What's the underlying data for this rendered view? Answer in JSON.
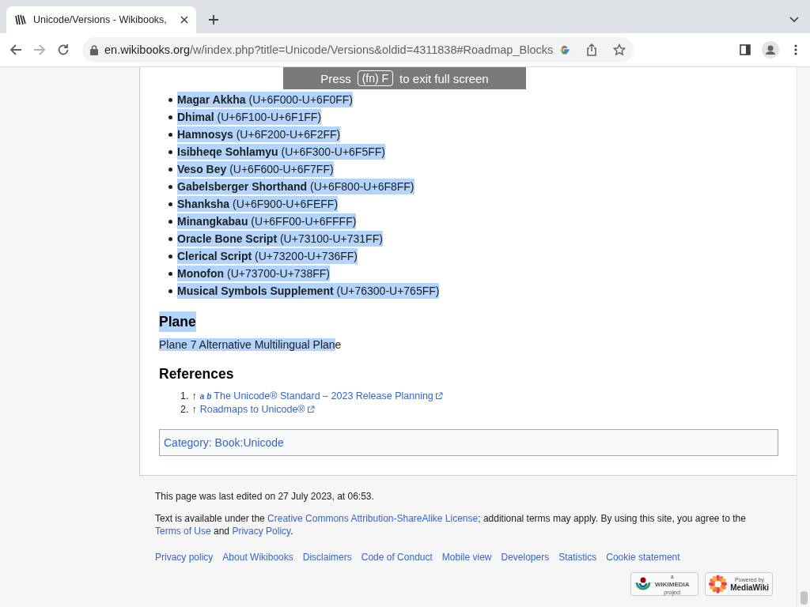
{
  "browser": {
    "tab": {
      "title": "Unicode/Versions - Wikibooks,",
      "selected": true
    },
    "back_enabled": true,
    "forward_enabled": false,
    "url": {
      "host": "en.wikibooks.org",
      "path": "/w/index.php?title=Unicode/Versions&oldid=4311838#Roadmap_Blocks"
    },
    "fullscreen_toast": {
      "before": "Press",
      "key": "(fn) F",
      "after": "to exit full screen"
    }
  },
  "blocks": [
    {
      "name": "Magar Akkha",
      "range": "(U+6F000-U+6F0FF)",
      "highlighted": true
    },
    {
      "name": "Dhimal",
      "range": "(U+6F100-U+6F1FF)",
      "highlighted": true
    },
    {
      "name": "Hamnosys",
      "range": "(U+6F200-U+6F2FF)",
      "highlighted": true
    },
    {
      "name": "Isibheqe Sohlamyu",
      "range": "(U+6F300-U+6F5FF)",
      "highlighted": true
    },
    {
      "name": "Veso Bey",
      "range": "(U+6F600-U+6F7FF)",
      "highlighted": true
    },
    {
      "name": "Gabelsberger Shorthand",
      "range": "(U+6F800-U+6F8FF)",
      "highlighted": true
    },
    {
      "name": "Shanksha",
      "range": "(U+6F900-U+6FEFF)",
      "highlighted": true
    },
    {
      "name": "Minangkabau",
      "range": "(U+6FF00-U+6FFFF)",
      "highlighted": true
    },
    {
      "name": "Oracle Bone Script",
      "range": "(U+73100-U+731FF)",
      "highlighted": true
    },
    {
      "name": "Clerical Script",
      "range": "(U+73200-U+736FF)",
      "highlighted": true
    },
    {
      "name": "Monofon",
      "range": "(U+73700-U+738FF)",
      "highlighted": true
    },
    {
      "name": "Musical Symbols Supplement",
      "range": "(U+76300-U+765FF)",
      "highlighted": true
    }
  ],
  "plane": {
    "heading": "Plane",
    "heading_highlighted": true,
    "text_highlighted": "Plane 7 Alternative Multilingual Plan",
    "text_rest": "e"
  },
  "references": {
    "heading": "References",
    "items": [
      {
        "number": "1.",
        "arrow": "↑",
        "backlinks": [
          "a",
          "b"
        ],
        "link": "The Unicode® Standard – 2023 Release Planning"
      },
      {
        "number": "2.",
        "arrow": "↑",
        "link": "Roadmaps to Unicode®"
      }
    ]
  },
  "category": {
    "label": "Category",
    "separator": ":",
    "value": "Book:Unicode"
  },
  "footer": {
    "last_edited": "This page was last edited on 27 July 2023, at 06:53.",
    "license": [
      {
        "kind": "text",
        "text": "Text is available under the "
      },
      {
        "kind": "link",
        "text": "Creative Commons Attribution-ShareAlike License"
      },
      {
        "kind": "text",
        "text": "; additional terms may apply. By using this site, you agree to the "
      },
      {
        "kind": "link",
        "text": "Terms of Use"
      },
      {
        "kind": "text",
        "text": " and "
      },
      {
        "kind": "link",
        "text": "Privacy Policy"
      },
      {
        "kind": "text",
        "text": "."
      }
    ],
    "links": [
      "Privacy policy",
      "About Wikibooks",
      "Disclaimers",
      "Code of Conduct",
      "Mobile view",
      "Developers",
      "Statistics",
      "Cookie statement"
    ],
    "badges": [
      {
        "kind": "wikimedia",
        "small": "a",
        "name": "WIKIMEDIA",
        "sub": "project"
      },
      {
        "kind": "mediawiki",
        "small": "Powered by",
        "name": "MediaWiki"
      }
    ]
  }
}
